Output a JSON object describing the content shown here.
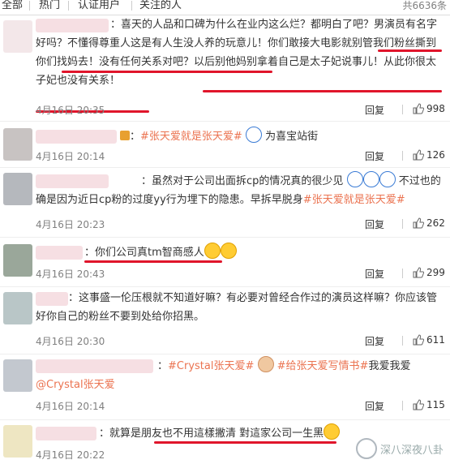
{
  "tabs": [
    "全部",
    "热门",
    "认证用户",
    "关注的人"
  ],
  "total_label": "共6636条",
  "comments": [
    {
      "text": "：喜天的人品和口碑为什么在业内这么烂？都明白了吧？男演员有名字好吗？不懂得尊重人这是有人生没人养的玩意儿！你们敢接大电影就别管我们粉丝撕到你们找妈去！没有任何关系对吧？以后别他妈别拿着自己是太子妃说事儿！从此你很太子妃也没有关系！",
      "date": "4月16日 20:35",
      "reply": "回复",
      "likes": "998"
    },
    {
      "text_a": "：",
      "topic": "#张天爱就是张天爱#",
      "text_b": "为喜宝站街",
      "date": "4月16日 20:14",
      "reply": "回复",
      "likes": "126"
    },
    {
      "text_a": "：虽然对于公司出面拆cp的情况真的很少见",
      "text_b": "不过也的确是因为近日cp粉的过度yy行为埋下的隐患。早拆早脱身",
      "topic": "#张天爱就是张天爱#",
      "date": "4月16日 20:23",
      "reply": "回复",
      "likes": "262"
    },
    {
      "text": "：你们公司真tm智商感人",
      "date": "4月16日 20:43",
      "reply": "回复",
      "likes": "299"
    },
    {
      "text": "：这事盛一伦压根就不知道好嘛？有必要对曾经合作过的演员这样嘛？你应该管好你自己的粉丝不要到处给你招黑。",
      "date": "4月16日 20:30",
      "reply": "回复",
      "likes": "611"
    },
    {
      "text_a": "：",
      "topic1": "#Crystal张天爱#",
      "topic2": "#给张天爱写情书#",
      "text_b": "我爱我爱",
      "mention": "@Crystal张天爱",
      "date": "4月16日 20:14",
      "reply": "回复",
      "likes": "115"
    },
    {
      "text": "：就算是朋友也不用這樣撇清 對這家公司一生黑",
      "date": "4月16日 20:22",
      "reply": "回复",
      "likes": ""
    }
  ],
  "watermark": "深八深夜八卦",
  "colors": {
    "topic": "#eb7350",
    "underline": "#e0152b",
    "meta": "#808080"
  }
}
